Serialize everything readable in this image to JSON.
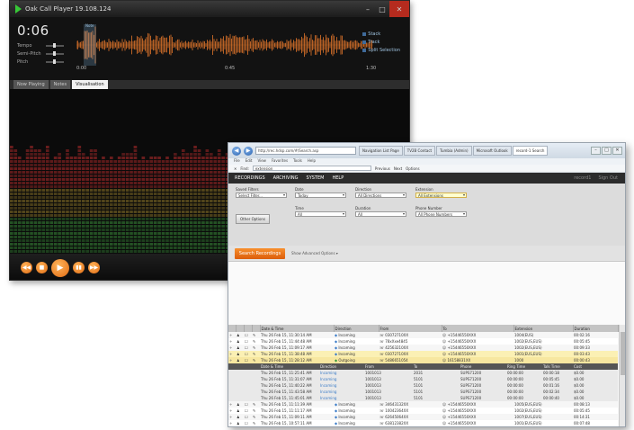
{
  "player": {
    "title": "Oak Call Player 19.108.124",
    "time": "0:06",
    "sliders": [
      {
        "label": "Tempo",
        "level": 0.45
      },
      {
        "label": "Semi-Pitch",
        "level": 0.45
      },
      {
        "label": "Pitch",
        "level": 0.45
      }
    ],
    "marker_label": "Note",
    "ticks": [
      "0:00",
      "0:45",
      "1:30"
    ],
    "channels": [
      "Stack",
      "Track",
      "Split Selection"
    ],
    "tabs": [
      {
        "label": "Now Playing",
        "active": false
      },
      {
        "label": "Notes",
        "active": false
      },
      {
        "label": "Visualisation",
        "active": true
      }
    ],
    "controls": [
      "◀◀",
      "■",
      "▶",
      "▮▮",
      "▶▶"
    ],
    "colors": {
      "wave": "#e4762b",
      "viz_red": "#8a2424",
      "viz_green": "#2d6a2d",
      "button": "#f08a2a"
    }
  },
  "browser": {
    "address": "http://rec.hdsp.com/#/Search.asp",
    "tabs": [
      {
        "label": "Navigation List Page",
        "active": false
      },
      {
        "label": "TV2B Contact",
        "active": false
      },
      {
        "label": "Tumbia (Admin)",
        "active": false
      },
      {
        "label": "Microsoft Outlook",
        "active": false
      },
      {
        "label": "record-1 Search",
        "active": true
      }
    ],
    "menu": [
      "File",
      "Edit",
      "View",
      "Favorites",
      "Tools",
      "Help"
    ],
    "find": {
      "label": "Find:",
      "value": "extension",
      "prev": "Previous",
      "next": "Next",
      "options": "Options"
    },
    "appnav": {
      "items": [
        "RECORDINGS",
        "ARCHIVING",
        "SYSTEM",
        "HELP"
      ],
      "right": [
        "record1",
        "Sign Out"
      ]
    },
    "filters": [
      {
        "label": "Saved Filters",
        "value": "Select Filter...",
        "hl": false
      },
      {
        "label": "Date",
        "value": "Today",
        "hl": false
      },
      {
        "label": "Direction",
        "value": "All Directions",
        "hl": false
      },
      {
        "label": "Extension",
        "value": "All Extensions",
        "hl": true
      },
      {
        "label": "Time",
        "value": "All",
        "hl": false
      },
      {
        "label": "Duration",
        "value": "All",
        "hl": false
      },
      {
        "label": "Phone Number",
        "value": "All Phone Numbers",
        "hl": false
      }
    ],
    "other_options": "Other Options",
    "search_button": "Search Recordings",
    "advanced": "Show Advanced Options ▾",
    "columns": [
      "Date & Time",
      "Direction",
      "From",
      "To",
      "Extension",
      "Duration"
    ],
    "rows": [
      {
        "dt": "Thu 26 Feb 15, 11:30:14 AM",
        "dir": "Incoming",
        "from": "03072710XX",
        "to": "+15446550XXX",
        "ext": "1004(EUS)",
        "dur": "00:02:16",
        "style": "row-a"
      },
      {
        "dt": "Thu 26 Feb 15, 11:44:48 AM",
        "dir": "Incoming",
        "from": "78xXxe4845",
        "to": "+15446550XXX",
        "ext": "1002(EUS,EUS)",
        "dur": "00:05:45",
        "style": "row-b"
      },
      {
        "dt": "Thu 26 Feb 15, 11:09:17 AM",
        "dir": "Incoming",
        "from": "42563210XX",
        "to": "+15446550XXX",
        "ext": "1002(EUS,EUS)",
        "dur": "00:09:33",
        "style": "row-a"
      },
      {
        "dt": "Thu 26 Feb 15, 11:38:48 AM",
        "dir": "Incoming",
        "from": "03072710XX",
        "to": "+15446550XXX",
        "ext": "1001(EUS,EUS)",
        "dur": "00:03:43",
        "style": "row-hl"
      },
      {
        "dt": "Thu 26 Feb 15, 11:28:12 AM",
        "dir": "Outgoing",
        "from": "5486651054",
        "to": "16158831XX",
        "ext": "1000",
        "dur": "00:00:43",
        "style": "row-hl2"
      }
    ],
    "sub_columns": [
      "Date & Time",
      "Direction",
      "From",
      "To",
      "Phone",
      "Ring Time",
      "Talk Time",
      "Cost"
    ],
    "sub_rows": [
      {
        "dt": "Thu 26 Feb 15, 11:25:41 AM",
        "dir": "Incoming",
        "from": "1001013",
        "to": "2031",
        "phone": "SUPS71200",
        "ring": "00:00:00",
        "talk": "00:00:18",
        "cost": "$0.00"
      },
      {
        "dt": "Thu 26 Feb 15, 11:31:07 AM",
        "dir": "Incoming",
        "from": "1001013",
        "to": "5101",
        "phone": "SUPS71200",
        "ring": "00:00:00",
        "talk": "00:05:45",
        "cost": "$0.00"
      },
      {
        "dt": "Thu 26 Feb 15, 11:40:22 AM",
        "dir": "Incoming",
        "from": "1001013",
        "to": "5101",
        "phone": "SUPS71200",
        "ring": "00:00:00",
        "talk": "00:01:16",
        "cost": "$0.00"
      },
      {
        "dt": "Thu 26 Feb 15, 11:43:58 AM",
        "dir": "Incoming",
        "from": "1001013",
        "to": "5101",
        "phone": "SUPS71200",
        "ring": "00:00:00",
        "talk": "00:02:34",
        "cost": "$0.00"
      },
      {
        "dt": "Thu 26 Feb 15, 11:45:01 AM",
        "dir": "Incoming",
        "from": "1001013",
        "to": "5101",
        "phone": "SUPS71200",
        "ring": "00:00:00",
        "talk": "00:00:40",
        "cost": "$0.00"
      }
    ],
    "rows2": [
      {
        "dt": "Thu 26 Feb 15, 11:11:39 AM",
        "dir": "Incoming",
        "from": "34643132XX",
        "to": "+15446550XXX",
        "ext": "1005(EUS,EUS)",
        "dur": "00:08:13",
        "style": "row-a"
      },
      {
        "dt": "Thu 26 Feb 15, 11:11:17 AM",
        "dir": "Incoming",
        "from": "10042364XX",
        "to": "+15446550XXX",
        "ext": "1002(EUS,EUS)",
        "dur": "00:05:45",
        "style": "row-b"
      },
      {
        "dt": "Thu 26 Feb 15, 11:09:11 AM",
        "dir": "Incoming",
        "from": "62645064XX",
        "to": "+15446550XXX",
        "ext": "1007(EUS,EUS)",
        "dur": "00:14:31",
        "style": "row-a"
      },
      {
        "dt": "Thu 26 Feb 15, 10:57:11 AM",
        "dir": "Incoming",
        "from": "63812382XX",
        "to": "+15446550XXX",
        "ext": "1001(EUS,EUS)",
        "dur": "00:07:48",
        "style": "row-b"
      },
      {
        "dt": "Thu 26 Feb 15, 10:55:33 AM",
        "dir": "Incoming",
        "from": "8374602769",
        "to": "+15446550XXX",
        "ext": "1002(EUS,EUS)",
        "dur": "00:13:08",
        "style": "row-a"
      },
      {
        "dt": "Thu 26 Feb 15, 10:47:31 AM",
        "dir": "Outgoing",
        "from": "5486651054",
        "to": "09130214XX",
        "ext": "1003",
        "dur": "00:01:22",
        "style": "row-b"
      },
      {
        "dt": "Thu 26 Feb 15, 10:39:14 AM",
        "dir": "Incoming",
        "from": "02763111XX",
        "to": "+15446550XXX",
        "ext": "1004(EUS)",
        "dur": "00:04:09",
        "style": "row-a"
      }
    ]
  }
}
